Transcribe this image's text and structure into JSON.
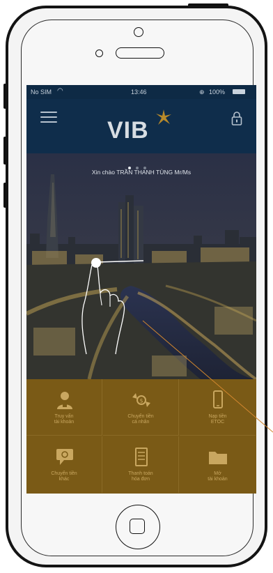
{
  "statusbar": {
    "carrier": "No SIM",
    "time": "13:46",
    "battery": "100%"
  },
  "header": {
    "logo_text": "VIB",
    "menu_icon": "hamburger-icon",
    "lock_icon": "lock-icon"
  },
  "hero": {
    "greeting": "Xin chào TRẦN THANH TÙNG Mr/Ms",
    "page_indicator": {
      "count": 3,
      "active": 1
    }
  },
  "quick_actions": [
    {
      "line1": "Truy vấn",
      "line2": "tài khoản",
      "icon": "user-icon"
    },
    {
      "line1": "Chuyển tiền",
      "line2": "cá nhân",
      "icon": "money-transfer-icon"
    },
    {
      "line1": "Nạp tiền",
      "line2": "ETOC",
      "icon": "phone-icon"
    },
    {
      "line1": "Chuyển tiền",
      "line2": "khác",
      "icon": "chat-transfer-icon"
    },
    {
      "line1": "Thanh toán",
      "line2": "hóa đơn",
      "icon": "bill-icon"
    },
    {
      "line1": "Mở",
      "line2": "tài khoản",
      "icon": "folder-icon"
    }
  ],
  "colors": {
    "header_bg": "#0f2d4b",
    "grid_bg": "#7a5a16",
    "logo_accent": "#f2b01e",
    "pointer_line": "#d0862e"
  }
}
